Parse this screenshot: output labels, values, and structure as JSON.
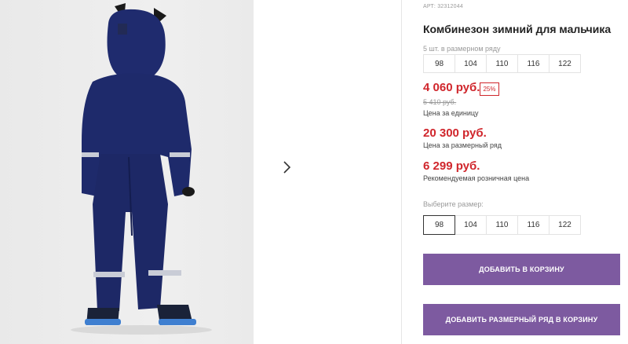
{
  "gallery": {
    "next_icon": "chevron-right-icon"
  },
  "product": {
    "article": "АРТ: 32312044",
    "title": "Комбинезон зимний для мальчика",
    "size_row_note": "5 шт. в размерном ряду",
    "size_row": [
      "98",
      "104",
      "110",
      "116",
      "122"
    ]
  },
  "pricing": {
    "unit_price": "4 060 руб.",
    "discount": "25%",
    "old_price": "5 410 руб.",
    "unit_label": "Цена за единицу",
    "row_price": "20 300 руб.",
    "row_label": "Цена за размерный ряд",
    "retail_price": "6 299 руб.",
    "retail_label": "Рекомендуемая розничная цена"
  },
  "size_select": {
    "label": "Выберите размер:",
    "options": [
      "98",
      "104",
      "110",
      "116",
      "122"
    ],
    "selected": "98"
  },
  "actions": {
    "add_to_cart": "ДОБАВИТЬ В КОРЗИНУ",
    "add_row_to_cart": "ДОБАВИТЬ РАЗМЕРНЫЙ РЯД В КОРЗИНУ"
  },
  "colors": {
    "accent": "#7d5aa0",
    "price": "#d0262c",
    "suit": "#1e2a6b"
  }
}
